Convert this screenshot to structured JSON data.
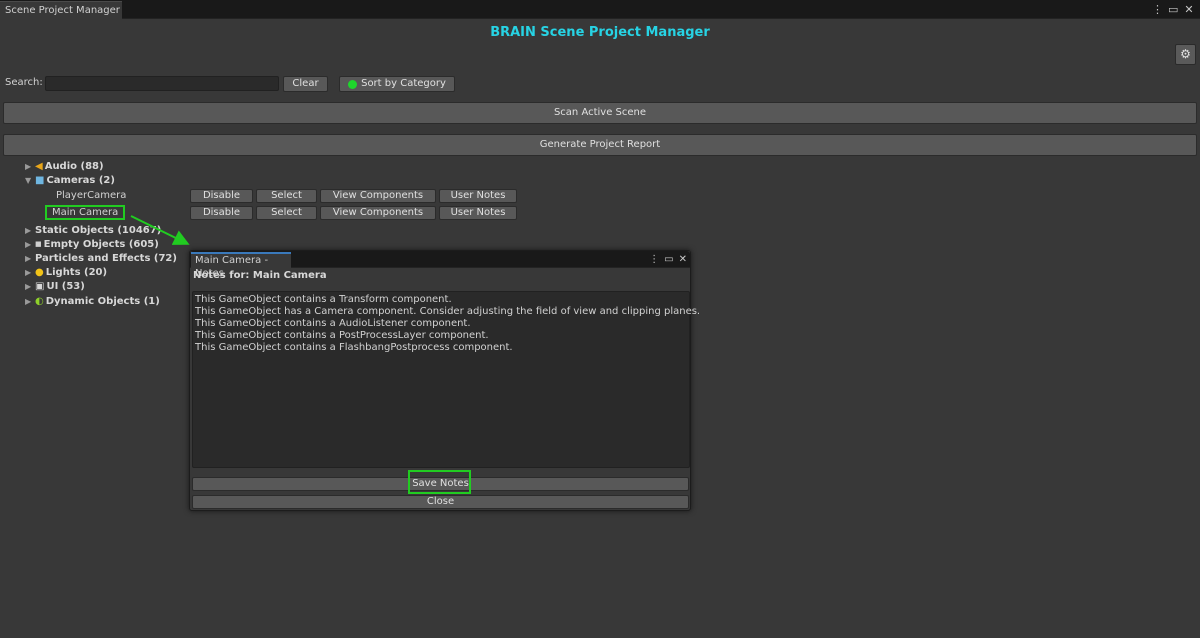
{
  "window": {
    "tab_label": "Scene Project Manager",
    "menu_icon": "kebab-menu-icon",
    "maximize_icon": "maximize-icon",
    "close_icon": "close-icon"
  },
  "header": {
    "title": "BRAIN Scene Project Manager",
    "title_color": "#27d3e4",
    "settings_icon": "gear-icon"
  },
  "search": {
    "label": "Search:",
    "value": "",
    "placeholder": "",
    "clear_label": "Clear",
    "sort_label": "Sort by Category",
    "sort_indicator_color": "#1ed62c"
  },
  "actions": {
    "scan_label": "Scan Active Scene",
    "report_label": "Generate Project Report"
  },
  "tree": {
    "categories": [
      {
        "label": "Audio (88)",
        "icon": "speaker-icon",
        "expanded": false
      },
      {
        "label": "Cameras (2)",
        "icon": "camera-icon",
        "expanded": true
      },
      {
        "label": "Static Objects (10467)",
        "icon": "",
        "expanded": false
      },
      {
        "label": "Empty Objects (605)",
        "icon": "folder-icon",
        "expanded": false
      },
      {
        "label": "Particles and Effects (72)",
        "icon": "",
        "expanded": false
      },
      {
        "label": "Lights (20)",
        "icon": "lightbulb-icon",
        "expanded": false
      },
      {
        "label": "UI (53)",
        "icon": "rect-transform-icon",
        "expanded": false
      },
      {
        "label": "Dynamic Objects (1)",
        "icon": "physics-icon",
        "expanded": false
      }
    ],
    "camera_children": [
      {
        "label": "PlayerCamera",
        "highlighted": false
      },
      {
        "label": "Main Camera",
        "highlighted": true
      }
    ],
    "row_buttons": {
      "disable": "Disable",
      "select": "Select",
      "view_components": "View Components",
      "user_notes": "User Notes"
    }
  },
  "notes_window": {
    "tab_label": "Main Camera - Notes",
    "header": "Notes for: Main Camera",
    "lines": [
      "This GameObject contains a Transform component.",
      "This GameObject has a Camera component. Consider adjusting the field of view and clipping planes.",
      "This GameObject contains a AudioListener component.",
      "This GameObject contains a PostProcessLayer component.",
      "This GameObject contains a FlashbangPostprocess component."
    ],
    "save_label": "Save Notes",
    "close_label": "Close"
  },
  "annotation": {
    "highlight_color": "#21cc21"
  }
}
